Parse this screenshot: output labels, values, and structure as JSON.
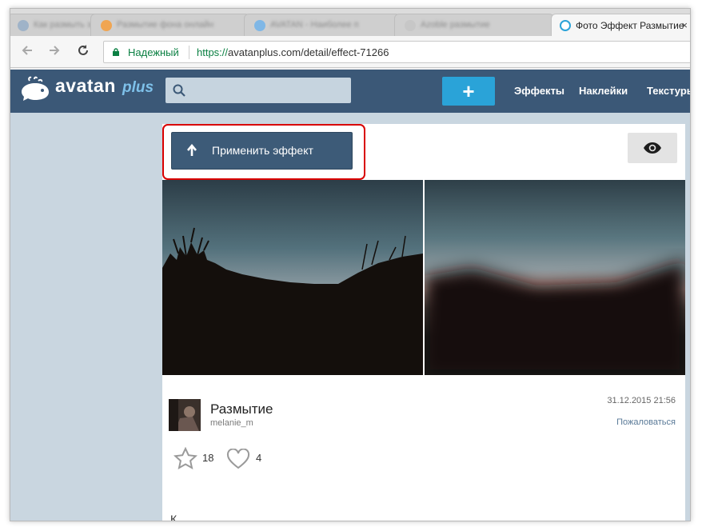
{
  "browser": {
    "tabs": [
      {
        "title": "Как размыть задний ф",
        "favicon_color": "#9fb3c8"
      },
      {
        "title": "Размытие фона онлайн",
        "favicon_color": "#f0a552"
      },
      {
        "title": "AVATAN - Наиболее п",
        "favicon_color": "#7fb7e6"
      },
      {
        "title": "Azoble размытие",
        "favicon_color": "#c7c7c7"
      },
      {
        "title": "Фото Эффект Размытие",
        "favicon_color": "#2aa3d8"
      }
    ],
    "active_tab_index": 4,
    "close_glyph": "×",
    "secure_label": "Надежный",
    "url_scheme": "https://",
    "url_rest": "avatanplus.com/detail/effect-71266"
  },
  "site": {
    "logo_text": "avatan",
    "logo_suffix": "plus",
    "search_placeholder": "",
    "add_label": "+",
    "nav": [
      "Эффекты",
      "Наклейки",
      "Текстуры"
    ],
    "colors": {
      "header": "#3b5877",
      "accent": "#2aa3d8",
      "page_bg": "#c9d6e0"
    }
  },
  "effect": {
    "apply_label": "Применить эффект",
    "title": "Размытие",
    "author": "melanie_m",
    "date": "31.12.2015 21:56",
    "report_label": "Пожаловаться",
    "favorites_count": "18",
    "likes_count": "4",
    "description_start": "К"
  }
}
